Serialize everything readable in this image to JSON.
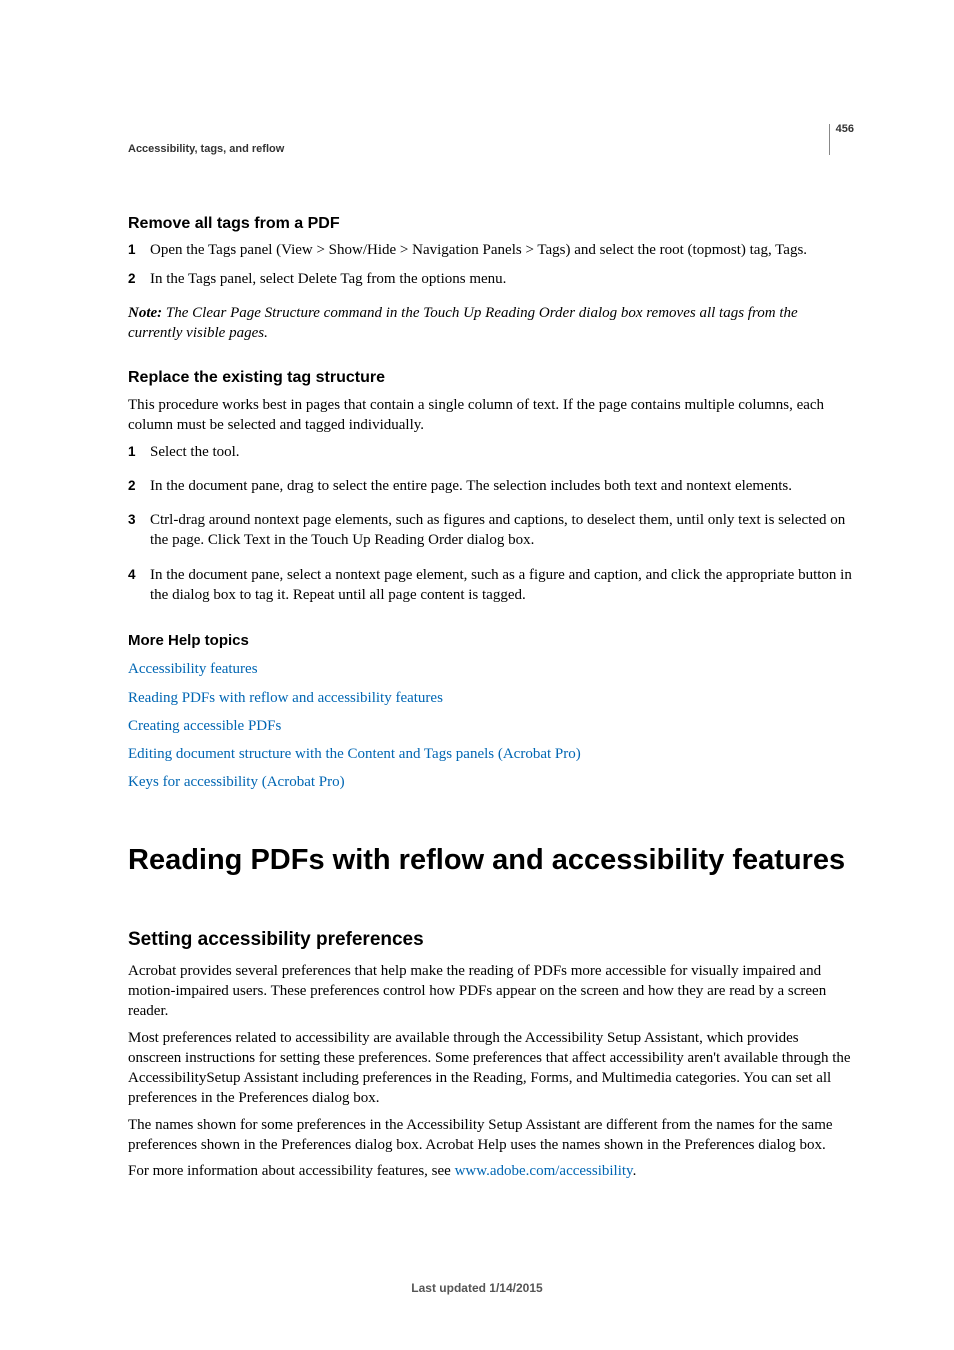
{
  "page_number": "456",
  "breadcrumb": "Accessibility, tags, and reflow",
  "section1": {
    "heading": "Remove all tags from a PDF",
    "steps": [
      "Open the Tags panel (View > Show/Hide > Navigation Panels > Tags) and select the root (topmost) tag, Tags.",
      "In the Tags panel, select Delete Tag from the options menu."
    ],
    "note_label": "Note:",
    "note_text": " The Clear Page Structure command in the Touch Up Reading Order dialog box removes all tags from the currently visible pages."
  },
  "section2": {
    "heading": "Replace the existing tag structure",
    "intro": "This procedure works best in pages that contain a single column of text. If the page contains multiple columns, each column must be selected and tagged individually.",
    "steps": [
      "Select the tool.",
      "In the document pane, drag to select the entire page. The selection includes both text and nontext elements.",
      "Ctrl-drag around nontext page elements, such as figures and captions, to deselect them, until only text is selected on the page. Click Text in the Touch Up Reading Order dialog box.",
      "In the document pane, select a nontext page element, such as a figure and caption, and click the appropriate button in the dialog box to tag it. Repeat until all page content is tagged."
    ]
  },
  "more_help": {
    "heading": "More Help topics",
    "links": [
      "Accessibility features",
      "Reading PDFs with reflow and accessibility features",
      "Creating accessible PDFs",
      "Editing document structure with the Content and Tags panels (Acrobat Pro)",
      "Keys for accessibility (Acrobat Pro)"
    ]
  },
  "chapter_heading": "Reading PDFs with reflow and accessibility features",
  "section3": {
    "heading": "Setting accessibility preferences",
    "p1": "Acrobat provides several preferences that help make the reading of PDFs more accessible for visually impaired and motion-impaired users. These preferences control how PDFs appear on the screen and how they are read by a screen reader.",
    "p2": "Most preferences related to accessibility are available through the Accessibility Setup Assistant, which provides onscreen instructions for setting these preferences. Some preferences that affect accessibility aren't available through the AccessibilitySetup Assistant including preferences in the Reading, Forms, and Multimedia categories. You can set all preferences in the Preferences dialog box.",
    "p3": "The names shown for some preferences in the Accessibility Setup Assistant are different from the names for the same preferences shown in the Preferences dialog box. Acrobat Help uses the names shown in the Preferences dialog box.",
    "p4_pre": "For more information about accessibility features, see ",
    "p4_link": "www.adobe.com/accessibility",
    "p4_post": "."
  },
  "footer": "Last updated 1/14/2015"
}
